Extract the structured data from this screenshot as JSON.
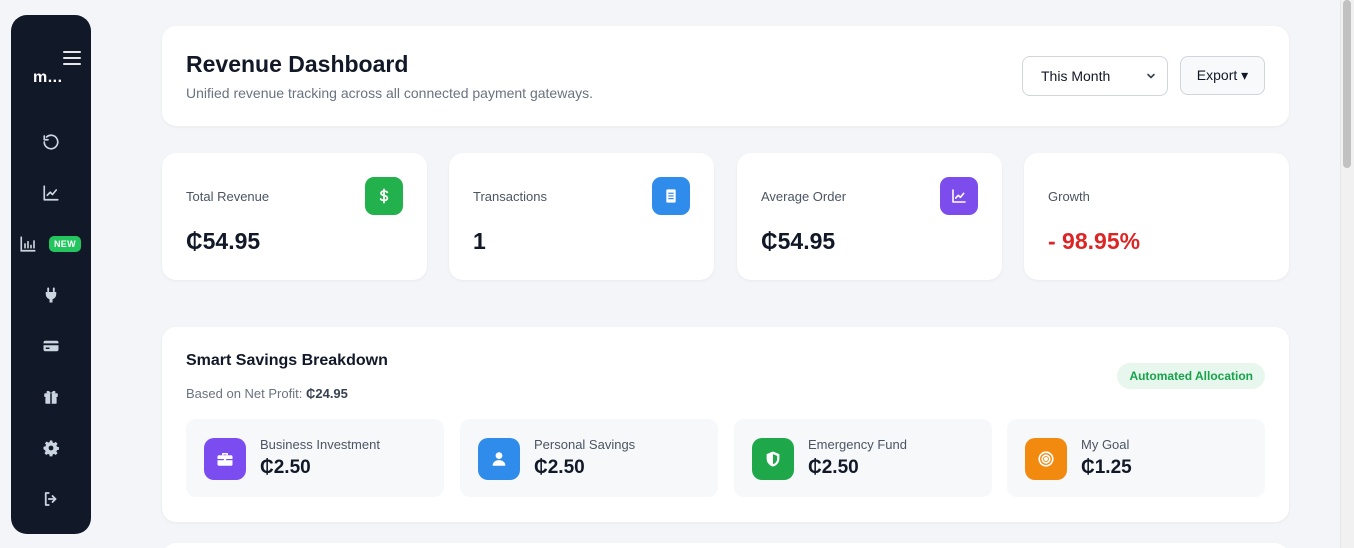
{
  "sidebar": {
    "brand": "m...",
    "items": [
      {
        "icon": "history-icon"
      },
      {
        "icon": "line-chart-icon"
      },
      {
        "icon": "bar-chart-icon",
        "badge": "NEW"
      },
      {
        "icon": "plug-icon"
      },
      {
        "icon": "credit-card-icon"
      },
      {
        "icon": "gift-icon"
      },
      {
        "icon": "gear-icon"
      },
      {
        "icon": "logout-icon"
      }
    ]
  },
  "header": {
    "title": "Revenue Dashboard",
    "subtitle": "Unified revenue tracking across all connected payment gateways.",
    "period_select": {
      "value": "This Month"
    },
    "export_label": "Export ▾"
  },
  "stats": [
    {
      "label": "Total Revenue",
      "value": "₵54.95",
      "icon": "dollar-icon",
      "color": "#22b14c"
    },
    {
      "label": "Transactions",
      "value": "1",
      "icon": "receipt-icon",
      "color": "#2f8ceb"
    },
    {
      "label": "Average Order",
      "value": "₵54.95",
      "icon": "chart-icon",
      "color": "#7c4dec"
    },
    {
      "label": "Growth",
      "value": "- 98.95%",
      "color": "#dc2626"
    }
  ],
  "savings": {
    "title": "Smart Savings Breakdown",
    "basis_label": "Based on Net Profit:",
    "basis_value": "₵24.95",
    "badge": "Automated Allocation",
    "items": [
      {
        "label": "Business Investment",
        "value": "₵2.50",
        "icon": "briefcase-icon",
        "color": "#7b4df0"
      },
      {
        "label": "Personal Savings",
        "value": "₵2.50",
        "icon": "user-icon",
        "color": "#2f8ceb"
      },
      {
        "label": "Emergency Fund",
        "value": "₵2.50",
        "icon": "shield-icon",
        "color": "#1fa84a"
      },
      {
        "label": "My Goal",
        "value": "₵1.25",
        "icon": "target-icon",
        "color": "#f28a10"
      }
    ]
  }
}
